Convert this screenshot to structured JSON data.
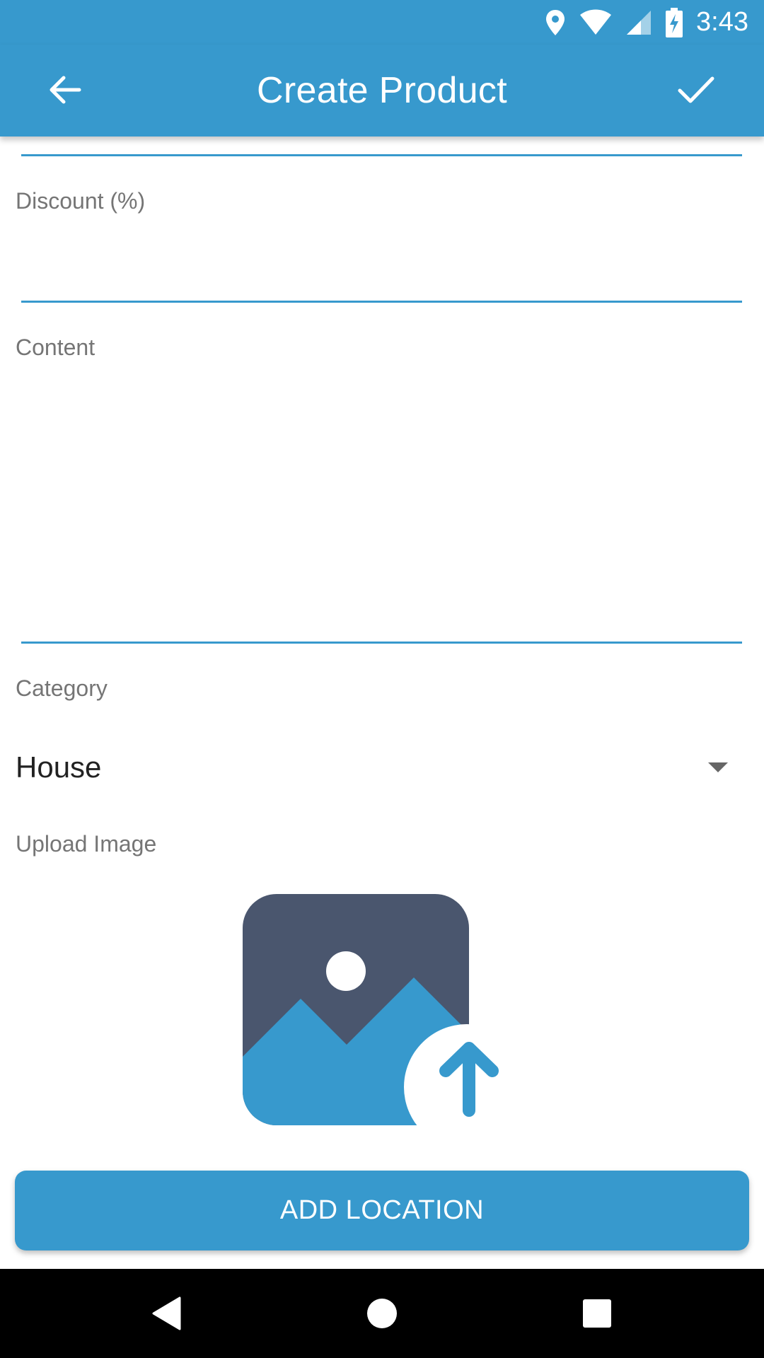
{
  "status_bar": {
    "time": "3:43",
    "icons": [
      "location-icon",
      "wifi-icon",
      "signal-icon",
      "battery-charging-icon"
    ]
  },
  "app_bar": {
    "title": "Create Product",
    "back_icon": "arrow-back-icon",
    "done_icon": "check-icon"
  },
  "form": {
    "discount": {
      "label": "Discount (%)",
      "value": ""
    },
    "content": {
      "label": "Content",
      "value": ""
    },
    "category": {
      "label": "Category",
      "selected": "House",
      "caret_icon": "dropdown-caret-icon"
    },
    "upload_image": {
      "label": "Upload Image",
      "icon": "image-upload-icon"
    }
  },
  "buttons": {
    "add_location": "ADD LOCATION"
  },
  "nav_bar": {
    "icons": [
      "back-triangle-icon",
      "home-circle-icon",
      "recents-square-icon"
    ]
  },
  "colors": {
    "primary": "#3799cd",
    "image_dark": "#4a566e",
    "label": "#757575",
    "text": "#222222"
  }
}
